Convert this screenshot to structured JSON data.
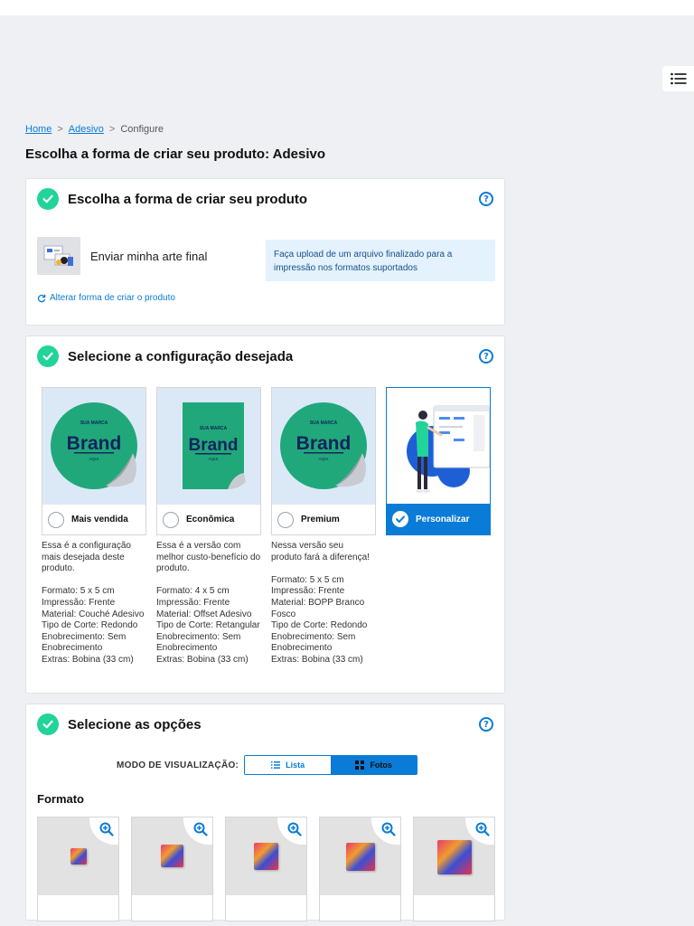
{
  "breadcrumb": {
    "home": "Home",
    "category": "Adesivo",
    "current": "Configure",
    "sep": ">"
  },
  "page_title": "Escolha a forma de criar seu produto: Adesivo",
  "section1": {
    "title": "Escolha a forma de criar seu produto",
    "option_label": "Enviar minha arte final",
    "info": "Faça upload de um arquivo finalizado para a impressão nos formatos suportados",
    "change_link": "Alterar forma de criar o produto"
  },
  "section2": {
    "title": "Selecione a configuração desejada",
    "brand_text": {
      "top": "SUA MARCA",
      "main": "Brand",
      "bottom": "AQUI"
    },
    "options": [
      {
        "label": "Mais vendida",
        "selected": false
      },
      {
        "label": "Econômica",
        "selected": false
      },
      {
        "label": "Premium",
        "selected": false
      },
      {
        "label": "Personalizar",
        "selected": true
      }
    ],
    "descriptions": [
      {
        "intro": "Essa é a configuração mais desejada deste produto.",
        "details": "Formato: 5 x 5 cm\nImpressão: Frente\nMaterial: Couché Adesivo\nTipo de Corte: Redondo\nEnobrecimento: Sem Enobrecimento\nExtras: Bobina (33 cm)"
      },
      {
        "intro": "Essa é a versão com melhor custo-benefício do produto.",
        "details": "Formato: 4 x 5 cm\nImpressão: Frente\nMaterial: Offset Adesivo\nTipo de Corte: Retangular\nEnobrecimento: Sem Enobrecimento\nExtras: Bobina (33 cm)"
      },
      {
        "intro": "Nessa versão seu produto fará a diferença!",
        "details": "Formato: 5 x 5 cm\nImpressão: Frente\nMaterial: BOPP Branco Fosco\nTipo de Corte: Redondo\nEnobrecimento: Sem Enobrecimento\nExtras: Bobina (33 cm)"
      }
    ]
  },
  "section3": {
    "title": "Selecione as opções",
    "view_mode_label": "MODO DE VISUALIZAÇÃO:",
    "view_list": "Lista",
    "view_photos": "Fotos",
    "active_view": "Fotos",
    "formato_label": "Formato"
  },
  "colors": {
    "accent": "#0a7bd6",
    "success": "#22d39a",
    "info_bg": "#e3f2fd",
    "brand_green": "#21a87a"
  },
  "icons": [
    "list-menu-icon",
    "check-icon",
    "help-icon",
    "refresh-icon",
    "list-icon",
    "grid-icon",
    "zoom-in-icon"
  ]
}
